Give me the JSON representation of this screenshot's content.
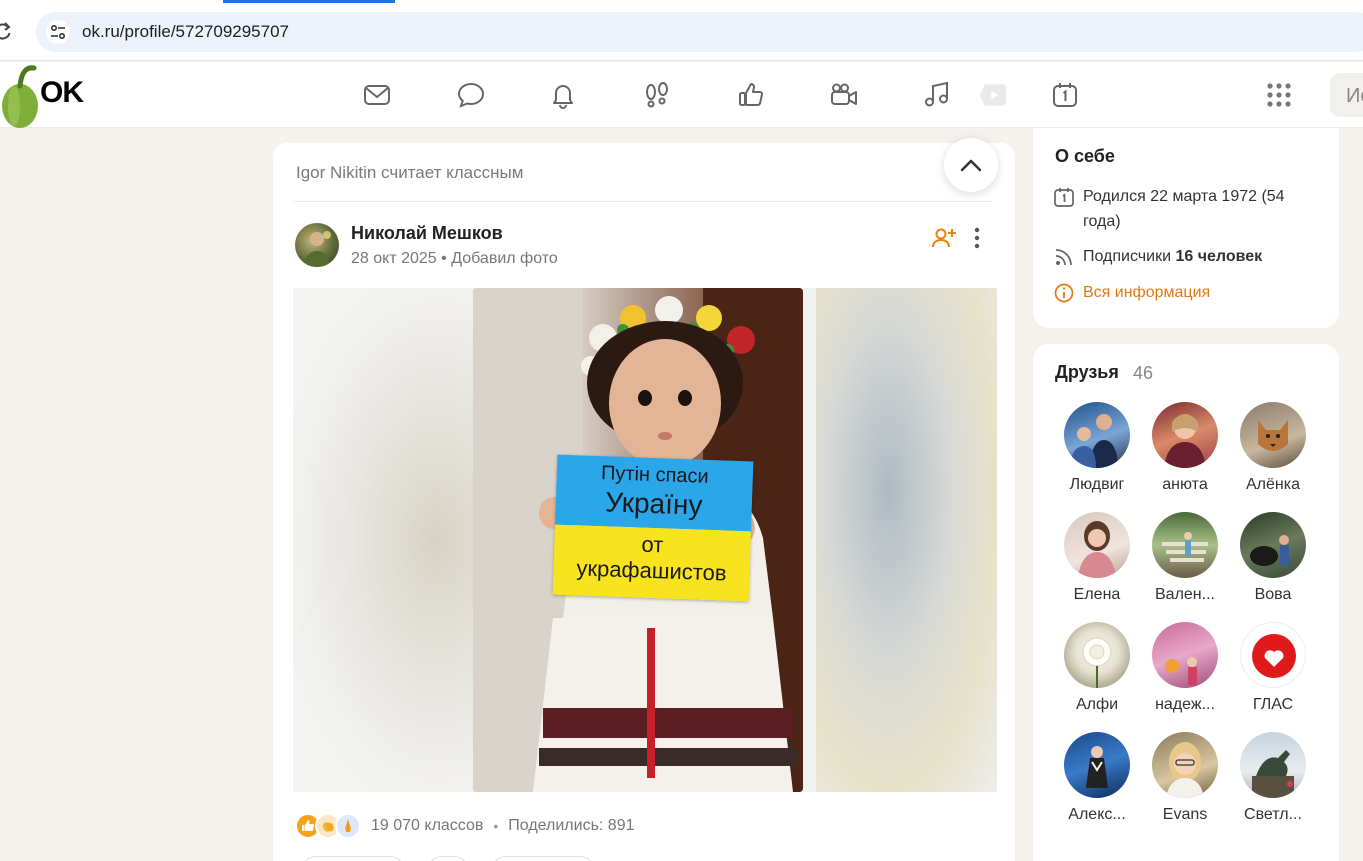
{
  "browser": {
    "url": "ok.ru/profile/572709295707"
  },
  "header": {
    "logo": "OK",
    "search_text": "Ис",
    "nav_icons": [
      "mail-icon",
      "chat-icon",
      "bell-icon",
      "footprints-icon",
      "like-icon",
      "video-camera-icon",
      "music-icon",
      "play-icon",
      "calendar-icon",
      "apps-grid-icon"
    ]
  },
  "feed": {
    "liked_by": "Igor Nikitin считает классным",
    "post": {
      "author": "Николай Мешков",
      "date": "28 окт 2025",
      "meta_separator": "•",
      "action": "Добавил фото",
      "photo_sign": {
        "line1": "Путін спаси",
        "line2": "Україну",
        "line3": "от",
        "line4": "украфашистов"
      },
      "reactions": {
        "likes_label": "19 070 классов",
        "separator": "•",
        "shares_label": "Поделились: 891"
      }
    }
  },
  "about": {
    "title": "О себе",
    "born": "Родился 22 марта 1972 (54 года)",
    "subscribers_prefix": "Подписчики",
    "subscribers_value": "16 человек",
    "all_info_link": "Вся информация"
  },
  "friends": {
    "title": "Друзья",
    "count": "46",
    "items": [
      {
        "name": "Людвиг"
      },
      {
        "name": "анюта"
      },
      {
        "name": "Алёнка"
      },
      {
        "name": "Елена"
      },
      {
        "name": "Вален..."
      },
      {
        "name": "Вова"
      },
      {
        "name": "Алфи"
      },
      {
        "name": "надеж..."
      },
      {
        "name": "ГЛАС"
      },
      {
        "name": "Алекс..."
      },
      {
        "name": "Evans"
      },
      {
        "name": "Светл..."
      }
    ]
  },
  "colors": {
    "accent_orange": "#ee8208",
    "link_orange": "#e07a10",
    "browser_blue": "#1a73e8"
  }
}
